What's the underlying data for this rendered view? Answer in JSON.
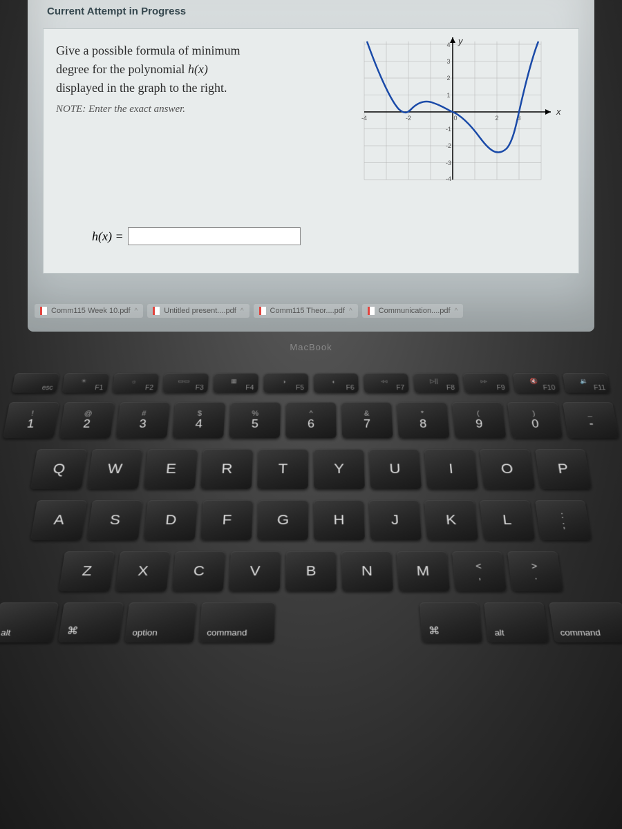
{
  "header": {
    "attempt": "Current Attempt in Progress"
  },
  "question": {
    "line1": "Give a possible formula of minimum",
    "line2": "degree for the polynomial ",
    "fx": "h(x)",
    "line3": "displayed in the graph to the right.",
    "note": "NOTE: Enter the exact answer."
  },
  "answer": {
    "label": "h(x) =",
    "value": ""
  },
  "downloads": [
    {
      "name": "Comm115 Week 10.pdf"
    },
    {
      "name": "Untitled present....pdf"
    },
    {
      "name": "Comm115 Theor....pdf"
    },
    {
      "name": "Communication....pdf"
    }
  ],
  "laptop_label": "MacBook",
  "chart_data": {
    "type": "line",
    "title": "",
    "xlabel": "x",
    "ylabel": "y",
    "xlim": [
      -4,
      4
    ],
    "ylim": [
      -4,
      4
    ],
    "x_ticks": [
      -4,
      -3,
      -2,
      -1,
      0,
      1,
      2,
      3,
      4
    ],
    "y_ticks": [
      -4,
      -3,
      -2,
      -1,
      0,
      1,
      2,
      3,
      4
    ],
    "roots": [
      -2,
      0,
      3
    ],
    "x": [
      -4,
      -3.5,
      -3,
      -2.5,
      -2,
      -1.5,
      -1,
      -0.5,
      0,
      0.5,
      1,
      1.5,
      2,
      2.5,
      3,
      3.5,
      4
    ],
    "y": [
      4.2,
      2.3,
      0.8,
      -0.2,
      0,
      0.35,
      0.3,
      0.12,
      0,
      -0.25,
      -0.8,
      -1.7,
      -2.7,
      -2.6,
      0,
      3.5,
      4.2
    ],
    "description": "Polynomial curve touching zero at x=-2 (double root behavior on left), passing through origin, dipping negative between 0 and 3, crossing zero at x=3 and rising steeply."
  },
  "keyboard": {
    "fn_row": [
      {
        "label": "esc",
        "sym": ""
      },
      {
        "label": "F1",
        "sym": "☀"
      },
      {
        "label": "F2",
        "sym": "☼"
      },
      {
        "label": "F3",
        "sym": "▭▭"
      },
      {
        "label": "F4",
        "sym": "▦"
      },
      {
        "label": "F5",
        "sym": "◑"
      },
      {
        "label": "F6",
        "sym": "◐"
      },
      {
        "label": "F7",
        "sym": "◃◃"
      },
      {
        "label": "F8",
        "sym": "▷||"
      },
      {
        "label": "F9",
        "sym": "▹▹"
      },
      {
        "label": "F10",
        "sym": "🔇"
      },
      {
        "label": "F11",
        "sym": "🔉"
      }
    ],
    "num_row": [
      {
        "top": "!",
        "bot": "1"
      },
      {
        "top": "@",
        "bot": "2"
      },
      {
        "top": "#",
        "bot": "3"
      },
      {
        "top": "$",
        "bot": "4"
      },
      {
        "top": "%",
        "bot": "5"
      },
      {
        "top": "^",
        "bot": "6"
      },
      {
        "top": "&",
        "bot": "7"
      },
      {
        "top": "*",
        "bot": "8"
      },
      {
        "top": "(",
        "bot": "9"
      },
      {
        "top": ")",
        "bot": "0"
      },
      {
        "top": "_",
        "bot": "-"
      }
    ],
    "q_row": [
      "Q",
      "W",
      "E",
      "R",
      "T",
      "Y",
      "U",
      "I",
      "O",
      "P"
    ],
    "a_row": [
      "A",
      "S",
      "D",
      "F",
      "G",
      "H",
      "J",
      "K",
      "L"
    ],
    "a_sym": {
      "top": ":",
      "bot": ";"
    },
    "z_row": [
      "Z",
      "X",
      "C",
      "V",
      "B",
      "N",
      "M"
    ],
    "z_syms": [
      {
        "top": "<",
        "bot": ","
      },
      {
        "top": ">",
        "bot": "."
      }
    ],
    "mods": {
      "alt": "alt",
      "option": "option",
      "command": "command",
      "cmd_sym": "⌘"
    }
  }
}
